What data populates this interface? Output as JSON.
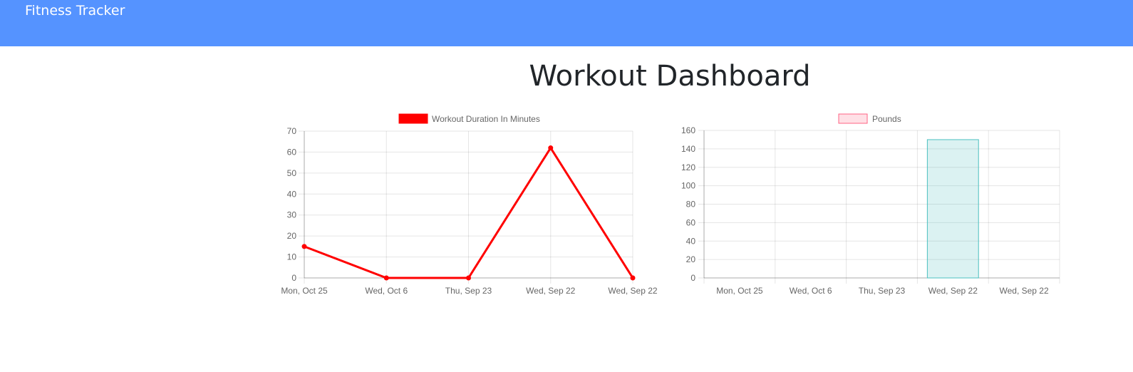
{
  "navbar": {
    "brand": "Fitness Tracker"
  },
  "main": {
    "title": "Workout Dashboard"
  },
  "chart_data": [
    {
      "type": "line",
      "categories": [
        "Mon, Oct 25",
        "Wed, Oct 6",
        "Thu, Sep 23",
        "Wed, Sep 22",
        "Wed, Sep 22"
      ],
      "series": [
        {
          "name": "Workout Duration In Minutes",
          "values": [
            15,
            0,
            0,
            62,
            0
          ],
          "color": "#ff0000"
        }
      ],
      "ylim": [
        0,
        70
      ],
      "yticks": [
        0,
        10,
        20,
        30,
        40,
        50,
        60,
        70
      ],
      "grid": true,
      "legend": "top-center",
      "title": "",
      "xlabel": "",
      "ylabel": ""
    },
    {
      "type": "bar",
      "categories": [
        "Mon, Oct 25",
        "Wed, Oct 6",
        "Thu, Sep 23",
        "Wed, Sep 22",
        "Wed, Sep 22"
      ],
      "series": [
        {
          "name": "Pounds",
          "values": [
            0,
            0,
            0,
            150,
            0
          ],
          "color": "#4bc0c0",
          "legend_color": "#ff6384"
        }
      ],
      "ylim": [
        0,
        160
      ],
      "yticks": [
        0,
        20,
        40,
        60,
        80,
        100,
        120,
        140,
        160
      ],
      "grid": true,
      "legend": "top-center",
      "title": "",
      "xlabel": "",
      "ylabel": ""
    }
  ]
}
